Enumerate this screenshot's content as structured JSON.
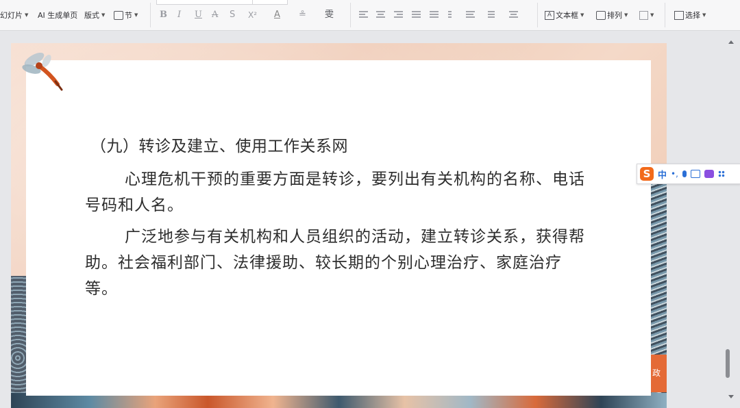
{
  "ribbon": {
    "slide_btn": "幻灯片",
    "ai_btn": "AI 生成单页",
    "layout_btn": "版式",
    "section_btn": "节",
    "textbox_btn": "文本框",
    "arrange_btn": "排列",
    "select_btn": "选择",
    "font_bold": "B",
    "font_italic": "I",
    "font_underline": "U",
    "font_strike": "A",
    "font_shadow": "S",
    "font_super": "X²",
    "font_color": "A",
    "highlight": "≗",
    "phonetic": "雯"
  },
  "slide": {
    "stamp_text": "政",
    "heading": "（九）转诊及建立、使用工作关系网",
    "paragraphs": [
      "心理危机干预的重要方面是转诊，要列出有关机构的名称、电话号码和人名。",
      "广泛地参与有关机构和人员组织的活动，建立转诊关系，获得帮助。社会福利部门、法律援助、较长期的个别心理治疗、家庭治疗等。"
    ]
  },
  "ime": {
    "lang": "中",
    "punct": "•,"
  },
  "colors": {
    "ime_logo": "#f26a1b",
    "ime_accent": "#2b6fd6",
    "slide_border": "#f0cdb9"
  }
}
